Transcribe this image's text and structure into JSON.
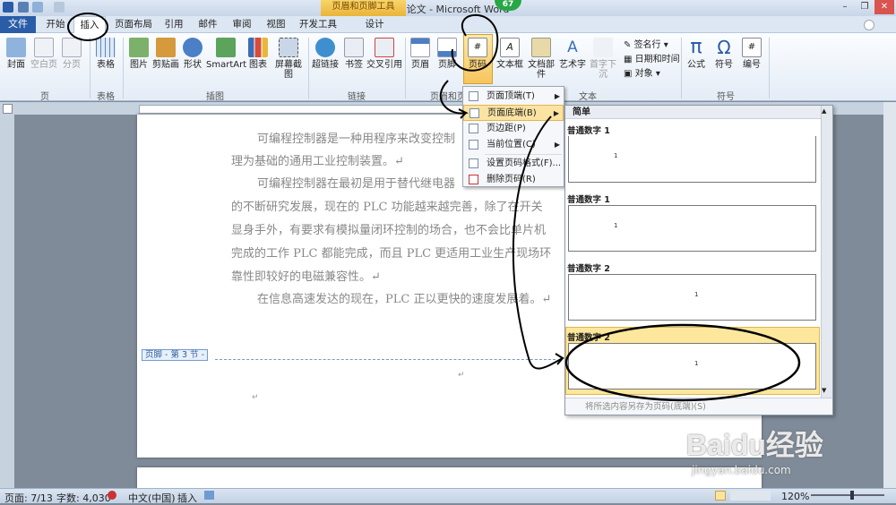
{
  "window": {
    "title": "毕业论文 - Microsoft Word",
    "context_tools": "页眉和页脚工具",
    "badge": "67"
  },
  "tabs": [
    {
      "label": "文件"
    },
    {
      "label": "开始"
    },
    {
      "label": "插入"
    },
    {
      "label": "页面布局"
    },
    {
      "label": "引用"
    },
    {
      "label": "邮件"
    },
    {
      "label": "审阅"
    },
    {
      "label": "视图"
    },
    {
      "label": "开发工具"
    },
    {
      "label": "设计"
    }
  ],
  "ribbon": {
    "buttons": [
      {
        "label": "封面"
      },
      {
        "label": "空白页"
      },
      {
        "label": "分页"
      },
      {
        "label": "表格"
      },
      {
        "label": "图片"
      },
      {
        "label": "剪贴画"
      },
      {
        "label": "形状"
      },
      {
        "label": "SmartArt"
      },
      {
        "label": "图表"
      },
      {
        "label": "屏幕截图"
      },
      {
        "label": "超链接"
      },
      {
        "label": "书签"
      },
      {
        "label": "交叉引用"
      },
      {
        "label": "页眉"
      },
      {
        "label": "页脚"
      },
      {
        "label": "页码"
      },
      {
        "label": "文本框"
      },
      {
        "label": "文档部件"
      },
      {
        "label": "艺术字"
      },
      {
        "label": "首字下沉"
      },
      {
        "label": "公式"
      },
      {
        "label": "符号"
      },
      {
        "label": "编号"
      }
    ],
    "small": {
      "sign": "签名行",
      "datetime": "日期和时间",
      "object": "对象"
    },
    "groups": [
      {
        "label": "页"
      },
      {
        "label": "表格"
      },
      {
        "label": "插图"
      },
      {
        "label": "链接"
      },
      {
        "label": "页眉和页脚"
      },
      {
        "label": "文本"
      },
      {
        "label": "符号"
      }
    ]
  },
  "menu": {
    "items": [
      {
        "label": "页面顶端(T)",
        "highlighted": false
      },
      {
        "label": "页面底端(B)",
        "highlighted": true
      },
      {
        "label": "页边距(P)",
        "highlighted": false
      },
      {
        "label": "当前位置(C)",
        "highlighted": false
      },
      {
        "label": "设置页码格式(F)...",
        "highlighted": false
      },
      {
        "label": "删除页码(R)",
        "highlighted": false
      }
    ]
  },
  "gallery": {
    "heading": "简单",
    "items": [
      {
        "label": "普通数字 1"
      },
      {
        "label": "普通数字 1"
      },
      {
        "label": "普通数字 2"
      },
      {
        "label": "普通数字 2"
      }
    ],
    "save_label": "将所选内容另存为页码(底端)(S)"
  },
  "document": {
    "paragraphs": [
      "可编程控制器是一种用程序来改变控制",
      "理为基础的通用工业控制装置。↵",
      "可编程控制器在最初是用于替代继电器",
      "的不断研究发展，现在的 PLC 功能越来越完善，除了在开关",
      "显身手外，有要求有模拟量闭环控制的场合，也不会比单片机",
      "完成的工作 PLC 都能完成，而且 PLC 更适用工业生产现场环",
      "靠性即较好的电磁兼容性。↵",
      "在信息高速发达的现在，PLC 正以更快的速度发展着。↵"
    ],
    "footer_label": "页脚 - 第 3 节 -",
    "para_mark": "↵"
  },
  "status": {
    "page": "页面: 7/13",
    "words": "字数: 4,030",
    "lang": "中文(中国)",
    "mode": "插入",
    "zoom": "120%"
  },
  "watermark": {
    "brand": "Baidu经验",
    "url": "jingyan.baidu.com"
  }
}
